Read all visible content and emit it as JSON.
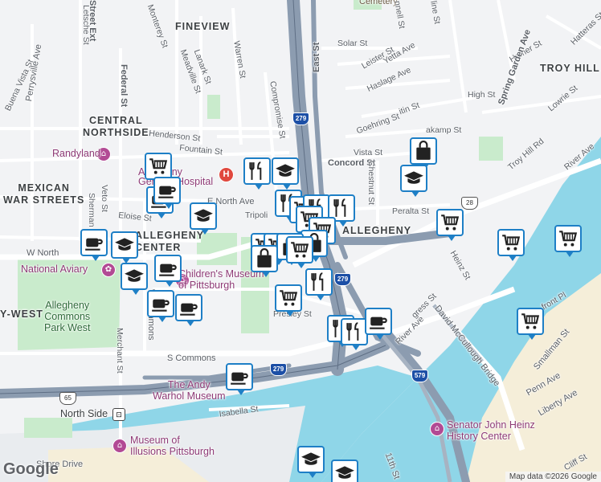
{
  "map": {
    "attribution": "Map data ©2026 Google",
    "logo": "Google",
    "colors": {
      "water": "#8fd6e8",
      "park": "#c9ebcc",
      "highway": "#8c9cb0",
      "pin_border": "#1e7fc6",
      "poi": "#b24a94"
    },
    "areas": {
      "fineview": "FINEVIEW",
      "central_northside": "CENTRAL\nNORTHSIDE",
      "mexican_war_streets": "MEXICAN\nWAR STREETS",
      "allegheny_center": "ALLEGHENY\nCENTER",
      "allegheny": "ALLEGHENY",
      "troy_hill": "TROY HILL",
      "allegheny_west": "Y-WEST"
    },
    "pois": {
      "randyland": "Randyland",
      "hospital": "Allegheny General Hospital",
      "national_aviary": "National Aviary",
      "childrens_museum": "Children's Museum\nof Pittsburgh",
      "commons_park": "Allegheny\nCommons\nPark West",
      "warhol": "The Andy\nWarhol Museum",
      "illusions": "Museum of\nIllusions Pittsburgh",
      "heinz": "Senator John Heinz\nHistory Center",
      "north_side": "North Side",
      "cemetery": "Cemetery"
    },
    "streets": {
      "letsche": "Letsche St",
      "street_ext": "Street Ext",
      "buena_vista": "Buena Vista St",
      "perrysville": "Perrysville Ave",
      "federal": "Federal St",
      "monterey": "Monterey St",
      "meadville": "Meadville St",
      "lanark": "Lanark St",
      "warren": "Warren St",
      "compromise": "Compromise St",
      "east": "East St",
      "solar": "Solar St",
      "leister": "Leister St",
      "yetta": "Yetta Ave",
      "haslage": "Haslage Ave",
      "homer": "Homer St",
      "hatteras": "Hatteras St",
      "spring_garden": "Spring Garden Ave",
      "lowrie": "Lowrie St",
      "high": "High St",
      "goehring": "Goehring St",
      "itin": "itin St",
      "henderson": "Henderson St",
      "fountain": "Fountain St",
      "vista": "Vista St",
      "concord": "Concord St",
      "troy_hill_rd": "Troy Hill Rd",
      "river_ave": "River Ave",
      "peralta": "Peralta St",
      "chestnut": "Chestnut St",
      "heinz_st": "Heinz St",
      "tripoli": "Tripoli",
      "e_north": "E North Ave",
      "w_north": "W North",
      "eloise": "Eloise St",
      "veto": "Veto St",
      "sherman": "Sherman Av",
      "w_commons": "W Commons",
      "merchant": "Merchant St",
      "s_commons": "S Commons",
      "isabella": "Isabella St",
      "mccullough": "David McCullough Bridge",
      "congress": "gress St",
      "river_ave2": "River Ave",
      "smallman": "Smallman St",
      "penn": "Penn Ave",
      "liberty": "Liberty Ave",
      "cliff": "Cliff St",
      "eleventh": "11th St",
      "waterfront": "front Pl",
      "presley": "Presley St",
      "shore": "Shore Drive",
      "kamp": "akamp St",
      "mannel": "nnell St",
      "fine": "line St"
    },
    "shields": {
      "i279_a": "279",
      "i279_b": "279",
      "i279_c": "279",
      "i579": "579",
      "r28": "28",
      "r65": "65"
    }
  }
}
